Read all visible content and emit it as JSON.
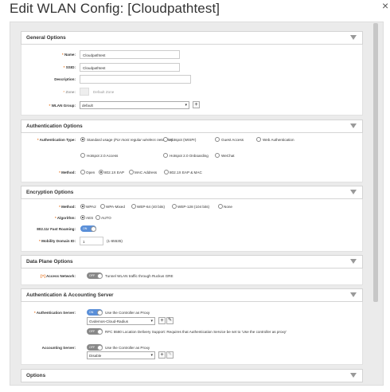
{
  "dialog": {
    "title": "Edit WLAN Config: [Cloudpathtest]",
    "close_glyph": "×"
  },
  "general": {
    "header": "General Options",
    "name_label": "Name:",
    "name_value": "Cloudpathtest",
    "ssid_label": "SSID:",
    "ssid_value": "Cloudpathtest",
    "description_label": "Description:",
    "description_value": "",
    "zone_label": "Zone:",
    "zone_value": "Default Zone",
    "wlan_group_label": "WLAN Group:",
    "wlan_group_value": "default",
    "required_mark": "*"
  },
  "auth": {
    "header": "Authentication Options",
    "type_label": "Authentication Type:",
    "options": [
      {
        "label": "Standard usage",
        "extra": "(For most regular wireless networks)",
        "selected": true
      },
      {
        "label": "Hotspot (WISPr)",
        "selected": false
      },
      {
        "label": "Guest Access",
        "selected": false
      },
      {
        "label": "Web Authentication",
        "selected": false
      },
      {
        "label": "Hotspot 2.0 Access",
        "selected": false
      },
      {
        "label": "Hotspot 2.0 Onboarding",
        "selected": false
      },
      {
        "label": "WeChat",
        "selected": false
      }
    ],
    "method_label": "Method:",
    "methods": [
      {
        "label": "Open",
        "selected": false
      },
      {
        "label": "802.1X EAP",
        "selected": true
      },
      {
        "label": "MAC Address",
        "selected": false
      },
      {
        "label": "802.1X EAP & MAC",
        "selected": false
      }
    ]
  },
  "encryption": {
    "header": "Encryption Options",
    "method_label": "Method:",
    "methods": [
      {
        "label": "WPA2",
        "selected": true
      },
      {
        "label": "WPA-Mixed",
        "selected": false
      },
      {
        "label": "WEP-64 (40 bits)",
        "selected": false
      },
      {
        "label": "WEP-128 (104 bits)",
        "selected": false
      },
      {
        "label": "None",
        "selected": false
      }
    ],
    "algorithm_label": "Algorithm:",
    "algorithms": [
      {
        "label": "AES",
        "selected": true
      },
      {
        "label": "AUTO",
        "selected": false
      }
    ],
    "fast_roaming_label": "802.11r Fast Roaming:",
    "fast_roaming_toggle": "ON",
    "mobility_label": "Mobility Domain ID:",
    "mobility_value": "1",
    "mobility_range": "(1-65535)"
  },
  "dataplane": {
    "header": "Data Plane Options",
    "access_network_marker": "[?]",
    "access_network_label": "Access Network:",
    "toggle": "OFF",
    "description": "Tunnel WLAN traffic through Ruckus GRE"
  },
  "accounting": {
    "header": "Authentication & Accounting Server",
    "auth_server_label": "Authentication Server:",
    "auth_toggle": "ON",
    "auth_use_proxy": "Use the Controller as Proxy",
    "auth_server_value": "Gvdemos-Cloud-Radius",
    "rfc_toggle": "OFF",
    "rfc_text": "RFC 5580 Location Delivery Support: Requires that Authentication Service be set to 'Use the controller as proxy'",
    "acct_server_label": "Accounting Server:",
    "acct_toggle": "OFF",
    "acct_use_proxy": "Use the Controller as Proxy",
    "acct_server_value": "Disable"
  },
  "options": {
    "header": "Options"
  },
  "buttons": {
    "plus": "+",
    "edit_icon": "pencil-icon"
  }
}
